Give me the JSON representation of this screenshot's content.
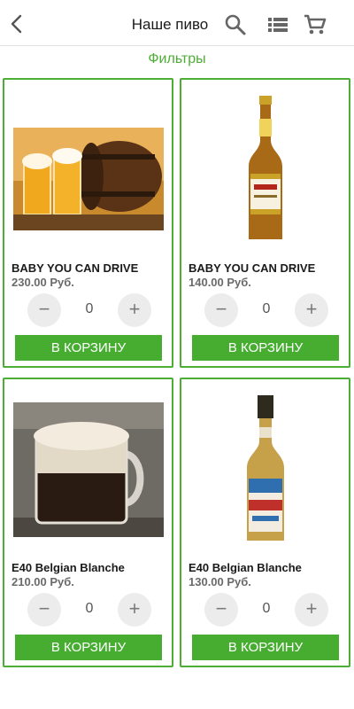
{
  "header": {
    "title": "Наше пиво",
    "back_icon": "chevron-left-icon",
    "search_icon": "search-icon",
    "list_icon": "list-view-icon",
    "cart_icon": "shopping-cart-icon"
  },
  "filters_label": "Фильтры",
  "colors": {
    "accent": "#46ad31",
    "border": "#4cae34",
    "stepper_bg": "#ececec"
  },
  "products": [
    {
      "name": "BABY YOU CAN DRIVE",
      "price": "230.00 Руб.",
      "qty": "0",
      "add_label": "В КОРЗИНУ",
      "image": "beer-glasses-and-barrel"
    },
    {
      "name": "BABY YOU CAN DRIVE",
      "price": "140.00 Руб.",
      "qty": "0",
      "add_label": "В КОРЗИНУ",
      "image": "beer-bottle-light"
    },
    {
      "name": "E40 Belgian Blanche",
      "price": "210.00 Руб.",
      "qty": "0",
      "add_label": "В КОРЗИНУ",
      "image": "dark-beer-mug"
    },
    {
      "name": "E40 Belgian Blanche",
      "price": "130.00 Руб.",
      "qty": "0",
      "add_label": "В КОРЗИНУ",
      "image": "beer-bottle-blanche"
    }
  ],
  "stepper": {
    "minus": "−",
    "plus": "+"
  }
}
